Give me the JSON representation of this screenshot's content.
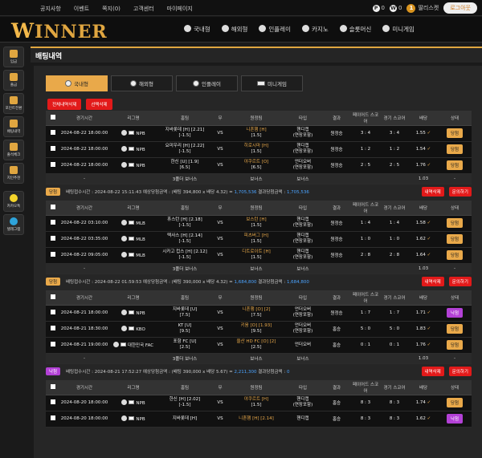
{
  "topbar": {
    "links": [
      "공지사항",
      "이벤트",
      "쪽지(0)",
      "고객센터",
      "마이페이지"
    ],
    "point": "0",
    "win_points": "0",
    "level": "1",
    "username": "딸리스켓",
    "logout": "로그아웃"
  },
  "logo": "WINNER",
  "nav": [
    "국내형",
    "해외형",
    "인플레이",
    "카지노",
    "슬롯머신",
    "미니게임"
  ],
  "sidebar": [
    "입금",
    "출금",
    "포인트전환",
    "배팅내역",
    "출석체크",
    "지인추천",
    "카카오톡",
    "텔레그램"
  ],
  "page_title": "배팅내역",
  "tabs": [
    "국내형",
    "해외형",
    "인플레이",
    "미니게임"
  ],
  "actions": {
    "delete_all": "전체내역삭제",
    "delete_selected": "선택삭제"
  },
  "headers": [
    "",
    "경기시간",
    "리그명",
    "홈팀",
    "무",
    "원정팀",
    "타입",
    "결과",
    "페이어드 스코어",
    "경기 스코어",
    "배당",
    "상태"
  ],
  "bets": [
    {
      "rows": [
        {
          "time": "2024-08-22 18:00:00",
          "league": "NPB",
          "home": "지바롯데 [H] [2.21]",
          "home_sub": "[-1.5]",
          "draw": "VS",
          "away": "니혼햄 [H]",
          "away_sub": "[1.5]",
          "type": "핸디캡",
          "type_sub": "(연장포함)",
          "result": "원정승",
          "pscore": "3 : 4",
          "gscore": "3 : 4",
          "odds": "1.55",
          "status": "당첨"
        },
        {
          "time": "2024-08-22 18:00:00",
          "league": "NPB",
          "home": "요미우리 [H] [2.22]",
          "home_sub": "[-1.5]",
          "draw": "VS",
          "away": "히로시마 [H]",
          "away_sub": "[1.5]",
          "type": "핸디캡",
          "type_sub": "(연장포함)",
          "result": "원정승",
          "pscore": "1 : 2",
          "gscore": "1 : 2",
          "odds": "1.54",
          "status": "당첨"
        },
        {
          "time": "2024-08-22 18:00:00",
          "league": "NPB",
          "home": "한신 [U] [1.9]",
          "home_sub": "[6.5]",
          "draw": "VS",
          "away": "야쿠르트 [O]",
          "away_sub": "[6.5]",
          "type": "언더오버",
          "type_sub": "(연장포함)",
          "result": "원정승",
          "pscore": "2 : 5",
          "gscore": "2 : 5",
          "odds": "1.76",
          "status": "당첨"
        }
      ],
      "footer": {
        "label": "3폴더 보너스",
        "bonus": "보너스",
        "type": "보너스",
        "odds": "1.03"
      },
      "summary": {
        "badge": "당첨",
        "time": "배팅접수시간 : 2024-08-22 15:11:43",
        "expected": "예상당첨금액 : (배팅 394,800 x 배당 4.32) = ",
        "expected_value": "1,705,536",
        "result": "결과당첨금액 : ",
        "result_value": "1,705,536",
        "delete": "내역삭제",
        "inquiry": "문의하기"
      }
    },
    {
      "rows": [
        {
          "time": "2024-08-22 03:10:00",
          "league": "MLB",
          "home": "휴스턴 [H] [2.18]",
          "home_sub": "[-1.5]",
          "draw": "VS",
          "away": "보스턴 [H]",
          "away_sub": "[1.5]",
          "type": "핸디캡",
          "type_sub": "(연장포함)",
          "result": "원정승",
          "pscore": "1 : 4",
          "gscore": "1 : 4",
          "odds": "1.58",
          "status": "당첨"
        },
        {
          "time": "2024-08-22 03:35:00",
          "league": "MLB",
          "home": "텍사스 [H] [2.14]",
          "home_sub": "[-1.5]",
          "draw": "VS",
          "away": "피츠버그 [H]",
          "away_sub": "[1.5]",
          "type": "핸디캡",
          "type_sub": "(연장포함)",
          "result": "원정승",
          "pscore": "1 : 0",
          "gscore": "1 : 0",
          "odds": "1.62",
          "status": "당첨"
        },
        {
          "time": "2024-08-22 09:05:00",
          "league": "MLB",
          "home": "시카고 컵스 [H] [2.12]",
          "home_sub": "[-1.5]",
          "draw": "VS",
          "away": "디트로이트 [H]",
          "away_sub": "[1.5]",
          "type": "핸디캡",
          "type_sub": "(연장포함)",
          "result": "원정승",
          "pscore": "2 : 8",
          "gscore": "2 : 8",
          "odds": "1.64",
          "status": "당첨"
        }
      ],
      "footer": {
        "label": "3폴더 보너스",
        "bonus": "보너스",
        "type": "보너스",
        "odds": "1.03"
      },
      "summary": {
        "badge": "당첨",
        "time": "배팅접수시간 : 2024-08-22 01:59:53",
        "expected": "예상당첨금액 : (배팅 390,000 x 배당 4.32) = ",
        "expected_value": "1,684,800",
        "result": "결과당첨금액 : ",
        "result_value": "1,684,800",
        "delete": "내역삭제",
        "inquiry": "문의하기"
      }
    },
    {
      "rows": [
        {
          "time": "2024-08-21 18:00:00",
          "league": "NPB",
          "home": "지바롯데 [U]",
          "home_sub": "[7.5]",
          "draw": "VS",
          "away": "니혼햄 [O] [2]",
          "away_sub": "[7.5]",
          "type": "언더오버",
          "type_sub": "(연장포함)",
          "result": "원정승",
          "pscore": "1 : 7",
          "gscore": "1 : 7",
          "odds": "1.71",
          "status": "낙첨"
        },
        {
          "time": "2024-08-21 18:30:00",
          "league": "KBO",
          "home": "KT [U]",
          "home_sub": "[9.5]",
          "draw": "VS",
          "away": "키움 [O] [1.93]",
          "away_sub": "[9.5]",
          "type": "언더오버",
          "type_sub": "(연장포함)",
          "result": "홈승",
          "pscore": "5 : 0",
          "gscore": "5 : 0",
          "odds": "1.83",
          "status": "당첨"
        },
        {
          "time": "2024-08-21 19:00:00",
          "league": "대한민국 FAC",
          "home": "포항 FC [U]",
          "home_sub": "[2.5]",
          "draw": "VS",
          "away": "울산 HD FC [O] [2]",
          "away_sub": "[2.5]",
          "type": "언더오버",
          "type_sub": "",
          "result": "홈승",
          "pscore": "0 : 1",
          "gscore": "0 : 1",
          "odds": "1.76",
          "status": "당첨"
        }
      ],
      "footer": {
        "label": "3폴더 보너스",
        "bonus": "보너스",
        "type": "보너스",
        "odds": "1.03"
      },
      "summary": {
        "badge": "낙첨",
        "time": "배팅접수시간 : 2024-08-21 17:52:27",
        "expected": "예상당첨금액 : (배팅 390,000 x 배당 5.67) = ",
        "expected_value": "2,211,300",
        "result": "결과당첨금액 : ",
        "result_value": "0",
        "delete": "내역삭제",
        "inquiry": "문의하기"
      }
    },
    {
      "rows": [
        {
          "time": "2024-08-20 18:00:00",
          "league": "NPB",
          "home": "한신 [H] [2.02]",
          "home_sub": "[-1.5]",
          "draw": "VS",
          "away": "야쿠르트 [H]",
          "away_sub": "[1.5]",
          "type": "핸디캡",
          "type_sub": "(연장포함)",
          "result": "홈승",
          "pscore": "8 : 3",
          "gscore": "8 : 3",
          "odds": "1.74",
          "status": "당첨"
        },
        {
          "time": "2024-08-20 18:00:00",
          "league": "NPB",
          "home": "지바롯데 [H]",
          "home_sub": "",
          "draw": "VS",
          "away": "니혼햄 [H] [2.14]",
          "away_sub": "",
          "type": "핸디캡",
          "type_sub": "",
          "result": "홈승",
          "pscore": "8 : 3",
          "gscore": "8 : 3",
          "odds": "1.62",
          "status": "낙첨"
        }
      ]
    }
  ]
}
